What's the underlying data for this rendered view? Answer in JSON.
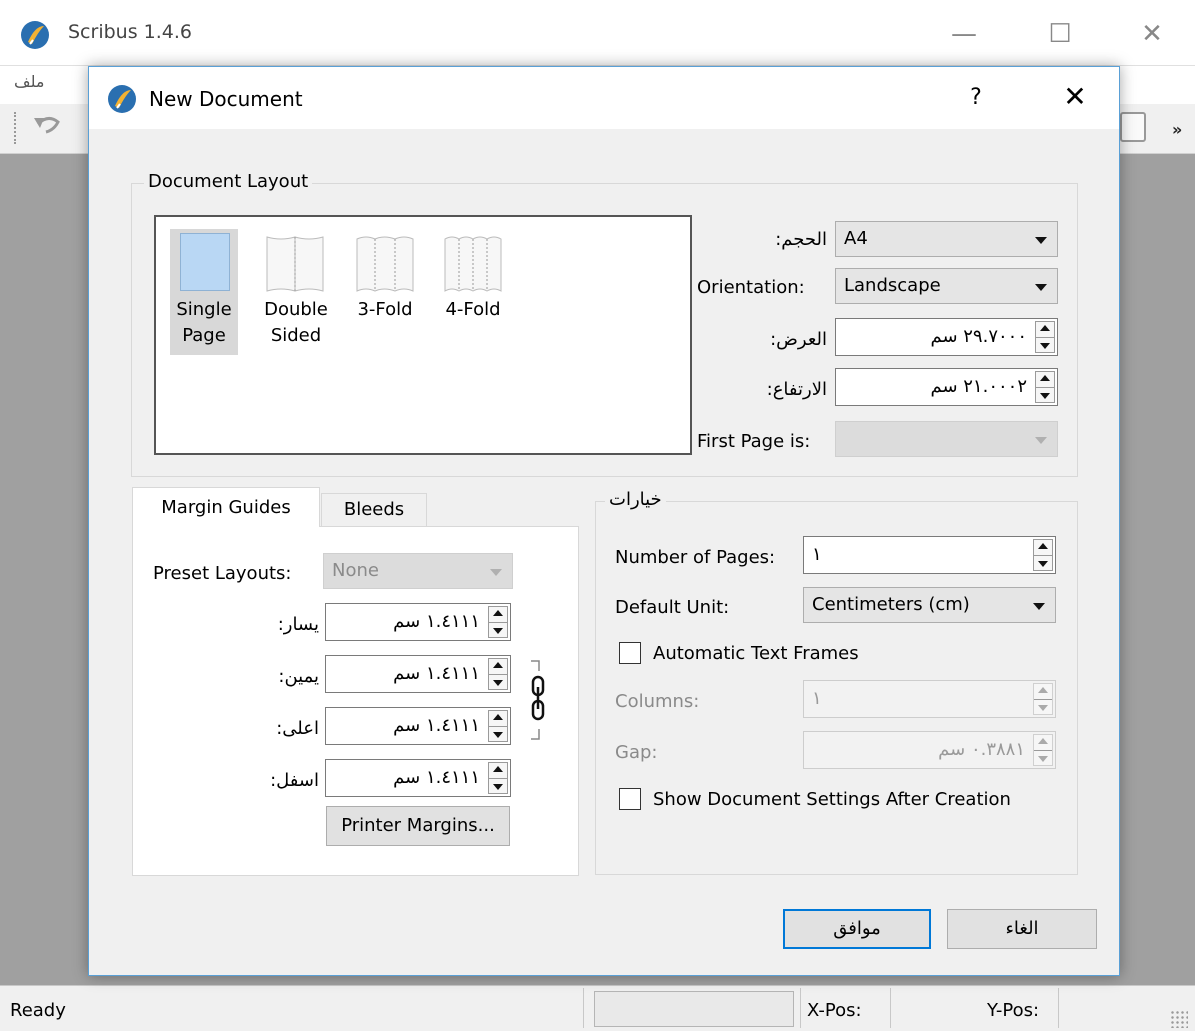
{
  "app": {
    "title": "Scribus 1.4.6",
    "menu_file": "ملف",
    "window_controls": {
      "minimize": "—",
      "maximize": "☐",
      "close": "✕"
    },
    "toolbar_more": "»"
  },
  "dialog": {
    "title": "New Document",
    "help": "?",
    "close": "✕",
    "document_layout": {
      "legend": "Document Layout",
      "layouts": [
        {
          "line1": "Single",
          "line2": "Page",
          "selected": true
        },
        {
          "line1": "Double",
          "line2": "Sided",
          "selected": false
        },
        {
          "line1": "3-Fold",
          "line2": "",
          "selected": false
        },
        {
          "line1": "4-Fold",
          "line2": "",
          "selected": false
        }
      ],
      "size_label": "الحجم:",
      "size_value": "A4",
      "orientation_label": "Orientation:",
      "orientation_value": "Landscape",
      "width_label": "العرض:",
      "width_value": "٢٩.٧٠٠٠ سم",
      "height_label": "الارتفاع:",
      "height_value": "٢١.٠٠٠٢ سم",
      "first_page_label": "First Page is:",
      "first_page_value": ""
    },
    "tabs": {
      "margin_guides": "Margin Guides",
      "bleeds": "Bleeds"
    },
    "margins": {
      "preset_label": "Preset Layouts:",
      "preset_value": "None",
      "left_label": "يسار:",
      "left_value": "١.٤١١١ سم",
      "right_label": "يمين:",
      "right_value": "١.٤١١١ سم",
      "top_label": "اعلى:",
      "top_value": "١.٤١١١ سم",
      "bottom_label": "اسفل:",
      "bottom_value": "١.٤١١١ سم",
      "printer_margins": "Printer Margins..."
    },
    "options": {
      "legend": "خيارات",
      "pages_label": "Number of Pages:",
      "pages_value": "١",
      "unit_label": "Default Unit:",
      "unit_value": "Centimeters (cm)",
      "auto_text_frames": "Automatic Text Frames",
      "columns_label": "Columns:",
      "columns_value": "١",
      "gap_label": "Gap:",
      "gap_value": "٠.٣٨٨١ سم",
      "show_settings": "Show Document Settings After Creation"
    },
    "ok_label": "موافق",
    "cancel_label": "الغاء"
  },
  "status": {
    "ready": "Ready",
    "xpos": "X-Pos:",
    "ypos": "Y-Pos:"
  }
}
